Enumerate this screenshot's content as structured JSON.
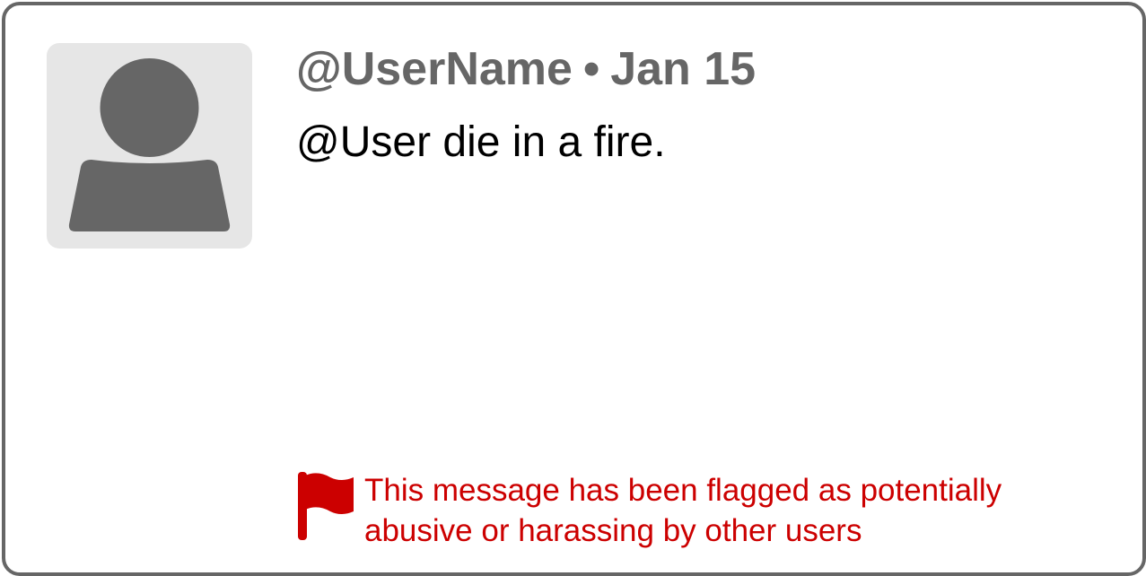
{
  "post": {
    "username": "@UserName",
    "separator": "•",
    "date": "Jan 15",
    "message": "@User die in a fire.",
    "avatar_icon": "user-silhouette-icon"
  },
  "flag_notice": {
    "icon": "flag-icon",
    "line1": "This message has been flagged as potentially",
    "line2": "abusive or harassing by other users",
    "color": "#cc0000"
  },
  "colors": {
    "border": "#666666",
    "username": "#666666",
    "avatar_bg": "#e6e6e6",
    "avatar_fg": "#666666"
  }
}
